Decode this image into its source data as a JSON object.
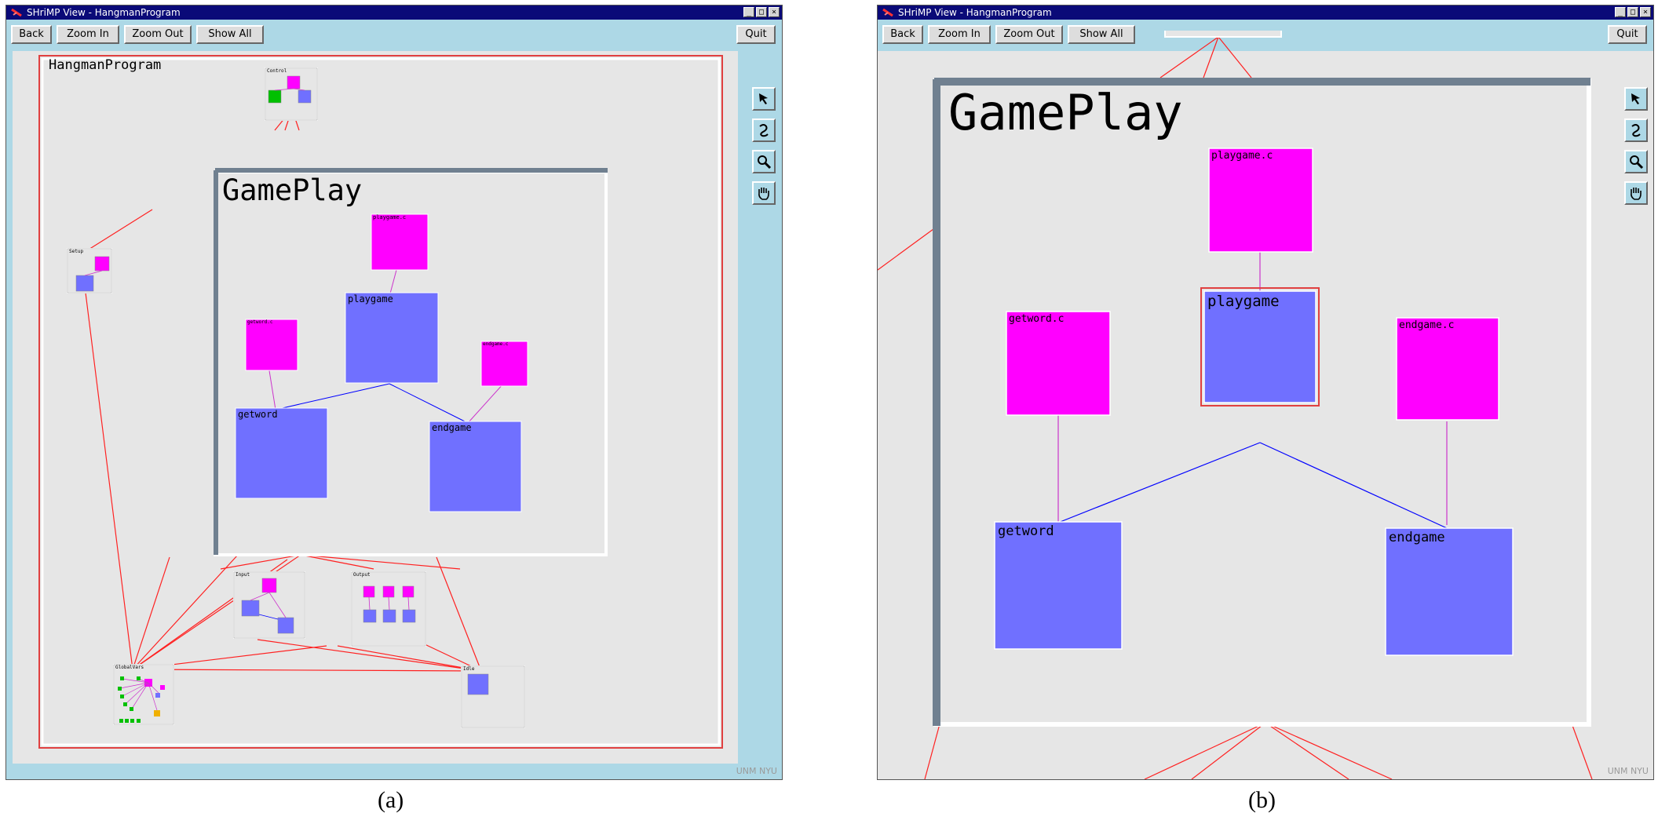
{
  "windows": {
    "a": {
      "title": "SHriMP View - HangmanProgram",
      "buttons": {
        "back": "Back",
        "zoom_in": "Zoom In",
        "zoom_out": "Zoom Out",
        "show_all": "Show All",
        "quit": "Quit"
      },
      "root_label": "HangmanProgram",
      "gameplay_label": "GamePlay",
      "node_labels": {
        "control": "Control",
        "setup": "Setup",
        "input": "Input",
        "output": "Output",
        "globalvars": "GlobalVars",
        "idle": "Idle",
        "playgame_c": "playgame.c",
        "playgame": "playgame",
        "getword_c": "getword.c",
        "getword": "getword",
        "endgame_c": "endgame.c",
        "endgame": "endgame"
      },
      "corner_text": "UNM NYU",
      "caption": "(a)"
    },
    "b": {
      "title": "SHriMP View - HangmanProgram",
      "buttons": {
        "back": "Back",
        "zoom_in": "Zoom In",
        "zoom_out": "Zoom Out",
        "show_all": "Show All",
        "quit": "Quit"
      },
      "gameplay_label": "GamePlay",
      "node_labels": {
        "playgame_c": "playgame.c",
        "playgame": "playgame",
        "getword_c": "getword.c",
        "getword": "getword",
        "endgame_c": "endgame.c",
        "endgame": "endgame"
      },
      "corner_text": "UNM NYU",
      "caption": "(b)"
    }
  },
  "tools": [
    "arrow-select-icon",
    "curve-lasso-icon",
    "magnifier-icon",
    "hand-pan-icon"
  ],
  "colors": {
    "titlebar": "#0a0a78",
    "toolbar": "#add8e6",
    "file_node": "#ff00ff",
    "function_node": "#7070ff",
    "variable_node": "#00c000",
    "type_node": "#f0b000",
    "call_arc": "#0000ff",
    "cross_arc": "#ff2020",
    "containment_arc": "#cc33cc",
    "gameplay_border": "#708090"
  }
}
